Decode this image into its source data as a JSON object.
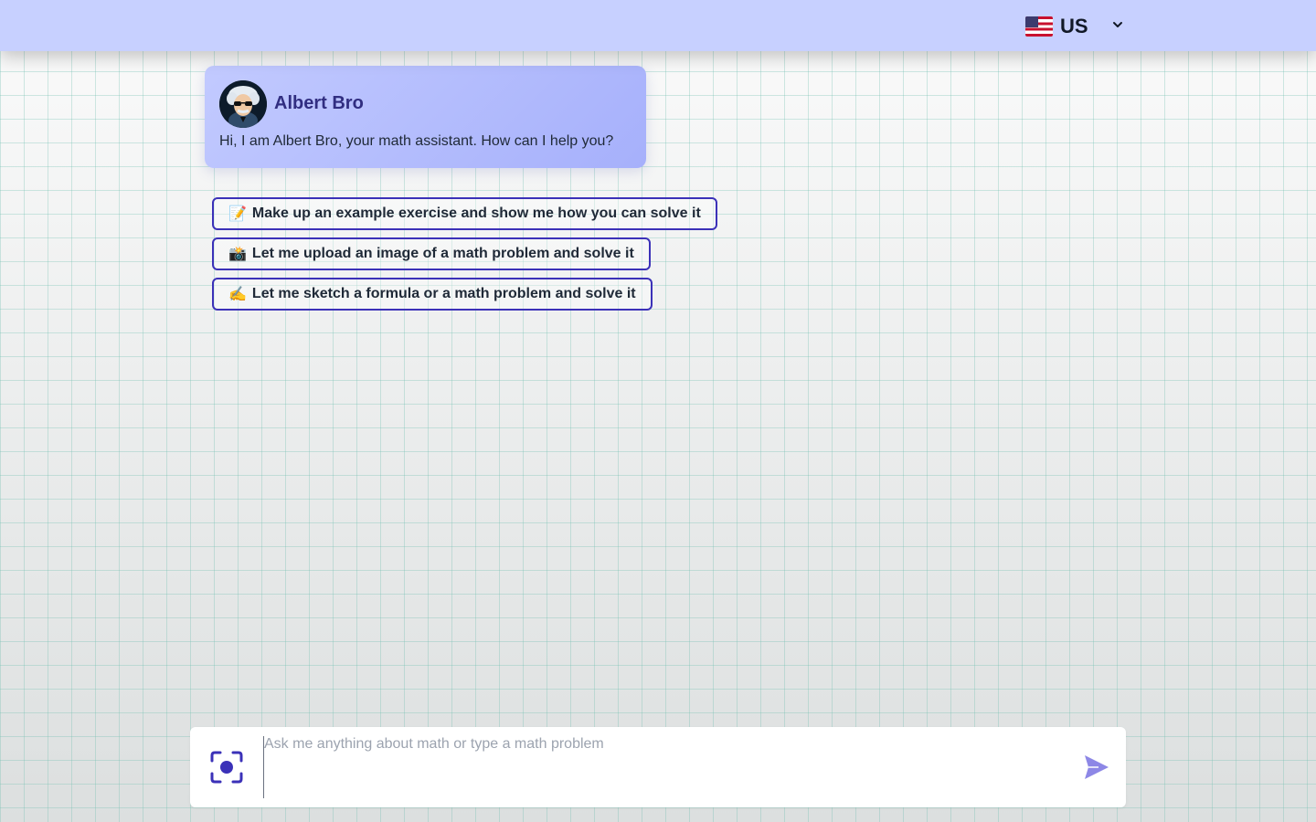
{
  "header": {
    "language": {
      "flag_icon": "us-flag-icon",
      "label": "US",
      "dropdown_icon": "chevron-down-icon"
    }
  },
  "chat": {
    "bot": {
      "name": "Albert Bro",
      "avatar_icon": "albert-avatar",
      "greeting": "Hi, I am Albert Bro, your math assistant. How can I help you?"
    },
    "suggestions": [
      {
        "emoji": "📝",
        "label": "Make up an example exercise and show me how you can solve it"
      },
      {
        "emoji": "📸",
        "label": "Let me upload an image of a math problem and solve it"
      },
      {
        "emoji": "✍️",
        "label": "Let me sketch a formula or a math problem and solve it"
      }
    ]
  },
  "composer": {
    "placeholder": "Ask me anything about math or type a math problem",
    "value": "",
    "scan_icon": "camera-scan-icon",
    "send_icon": "send-icon"
  },
  "colors": {
    "header_bg": "#c7d0ff",
    "accent": "#3b31b8",
    "bot_card_start": "#c2caff",
    "bot_card_end": "#a6b0fb",
    "send": "#8d87e6"
  }
}
